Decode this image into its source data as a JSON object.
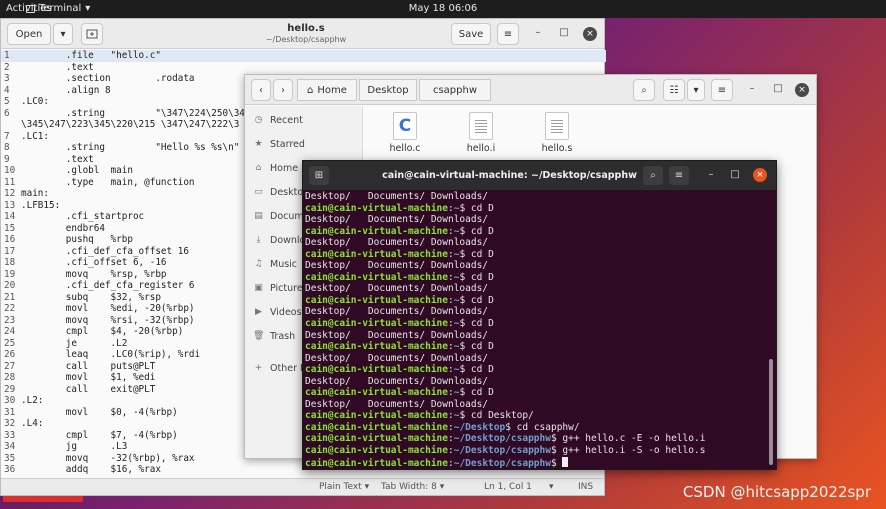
{
  "topbar": {
    "activities": "Activities",
    "app": "Terminal",
    "app_arrow": "▾",
    "clock": "May 18  06:06"
  },
  "editor": {
    "open_label": "Open",
    "open_arrow": "▾",
    "title": "hello.s",
    "subtitle": "~/Desktop/csapphw",
    "save_label": "Save",
    "lines": [
      {
        "n": "1",
        "t": "        .file   \"hello.c\""
      },
      {
        "n": "2",
        "t": "        .text"
      },
      {
        "n": "3",
        "t": "        .section        .rodata"
      },
      {
        "n": "4",
        "t": "        .align 8"
      },
      {
        "n": "5",
        "t": ".LC0:"
      },
      {
        "n": "6",
        "t": "        .string         \"\\347\\224\\250\\34"
      },
      {
        "n": "",
        "t": "\\345\\247\\223\\345\\220\\215 \\347\\247\\222\\3"
      },
      {
        "n": "7",
        "t": ".LC1:"
      },
      {
        "n": "8",
        "t": "        .string         \"Hello %s %s\\n\""
      },
      {
        "n": "9",
        "t": "        .text"
      },
      {
        "n": "10",
        "t": "        .globl  main"
      },
      {
        "n": "11",
        "t": "        .type   main, @function"
      },
      {
        "n": "12",
        "t": "main:"
      },
      {
        "n": "13",
        "t": ".LFB15:"
      },
      {
        "n": "14",
        "t": "        .cfi_startproc"
      },
      {
        "n": "15",
        "t": "        endbr64"
      },
      {
        "n": "16",
        "t": "        pushq   %rbp"
      },
      {
        "n": "17",
        "t": "        .cfi_def_cfa_offset 16"
      },
      {
        "n": "18",
        "t": "        .cfi_offset 6, -16"
      },
      {
        "n": "19",
        "t": "        movq    %rsp, %rbp"
      },
      {
        "n": "20",
        "t": "        .cfi_def_cfa_register 6"
      },
      {
        "n": "21",
        "t": "        subq    $32, %rsp"
      },
      {
        "n": "22",
        "t": "        movl    %edi, -20(%rbp)"
      },
      {
        "n": "23",
        "t": "        movq    %rsi, -32(%rbp)"
      },
      {
        "n": "24",
        "t": "        cmpl    $4, -20(%rbp)"
      },
      {
        "n": "25",
        "t": "        je      .L2"
      },
      {
        "n": "26",
        "t": "        leaq    .LC0(%rip), %rdi"
      },
      {
        "n": "27",
        "t": "        call    puts@PLT"
      },
      {
        "n": "28",
        "t": "        movl    $1, %edi"
      },
      {
        "n": "29",
        "t": "        call    exit@PLT"
      },
      {
        "n": "30",
        "t": ".L2:"
      },
      {
        "n": "31",
        "t": "        movl    $0, -4(%rbp)"
      },
      {
        "n": "32",
        "t": ".L4:"
      },
      {
        "n": "33",
        "t": "        cmpl    $7, -4(%rbp)"
      },
      {
        "n": "34",
        "t": "        jg      .L3"
      },
      {
        "n": "35",
        "t": "        movq    -32(%rbp), %rax"
      },
      {
        "n": "36",
        "t": "        addq    $16, %rax"
      }
    ],
    "status": {
      "mode": "Plain Text ▾",
      "tab": "Tab Width: 8 ▾",
      "pos": "Ln 1, Col 1",
      "pos_arrow": "▾",
      "ins": "INS"
    }
  },
  "files": {
    "crumbs": [
      "Home",
      "Desktop",
      "csapphw"
    ],
    "sidebar": [
      {
        "icon": "◷",
        "label": "Recent"
      },
      {
        "icon": "★",
        "label": "Starred"
      },
      {
        "icon": "⌂",
        "label": "Home"
      },
      {
        "icon": "▭",
        "label": "Desktop"
      },
      {
        "icon": "▤",
        "label": "Documents"
      },
      {
        "icon": "⤓",
        "label": "Downloads"
      },
      {
        "icon": "♫",
        "label": "Music"
      },
      {
        "icon": "▣",
        "label": "Pictures"
      },
      {
        "icon": "▶",
        "label": "Videos"
      },
      {
        "icon": "🗑",
        "label": "Trash"
      },
      {
        "icon": "+",
        "label": "Other Locations"
      }
    ],
    "items": [
      {
        "name": "hello.c",
        "kind": "c-source-icon",
        "glyph": "C"
      },
      {
        "name": "hello.i",
        "kind": "text-file-icon"
      },
      {
        "name": "hello.s",
        "kind": "text-file-icon"
      }
    ]
  },
  "terminal": {
    "title": "cain@cain-virtual-machine: ~/Desktop/csapphw",
    "user": "cain@cain-virtual-machine",
    "lines": [
      {
        "out": "Desktop/   Documents/ Downloads/"
      },
      {
        "path": "~",
        "cmd": "cd D"
      },
      {
        "out": "Desktop/   Documents/ Downloads/"
      },
      {
        "path": "~",
        "cmd": "cd D"
      },
      {
        "out": "Desktop/   Documents/ Downloads/"
      },
      {
        "path": "~",
        "cmd": "cd D"
      },
      {
        "out": "Desktop/   Documents/ Downloads/"
      },
      {
        "path": "~",
        "cmd": "cd D"
      },
      {
        "out": "Desktop/   Documents/ Downloads/"
      },
      {
        "path": "~",
        "cmd": "cd D"
      },
      {
        "out": "Desktop/   Documents/ Downloads/"
      },
      {
        "path": "~",
        "cmd": "cd D"
      },
      {
        "out": "Desktop/   Documents/ Downloads/"
      },
      {
        "path": "~",
        "cmd": "cd D"
      },
      {
        "out": "Desktop/   Documents/ Downloads/"
      },
      {
        "path": "~",
        "cmd": "cd D"
      },
      {
        "out": "Desktop/   Documents/ Downloads/"
      },
      {
        "path": "~",
        "cmd": "cd D"
      },
      {
        "out": "Desktop/   Documents/ Downloads/"
      },
      {
        "path": "~",
        "cmd": "cd Desktop/"
      },
      {
        "path": "~/Desktop",
        "cmd": "cd csapphw/"
      },
      {
        "path": "~/Desktop/csapphw",
        "cmd": "g++ hello.c -E -o hello.i"
      },
      {
        "path": "~/Desktop/csapphw",
        "cmd": "g++ hello.i -S -o hello.s"
      },
      {
        "path": "~/Desktop/csapphw",
        "cmd": "",
        "cursor": true
      }
    ]
  },
  "watermark": "CSDN @hitcsapp2022spr"
}
